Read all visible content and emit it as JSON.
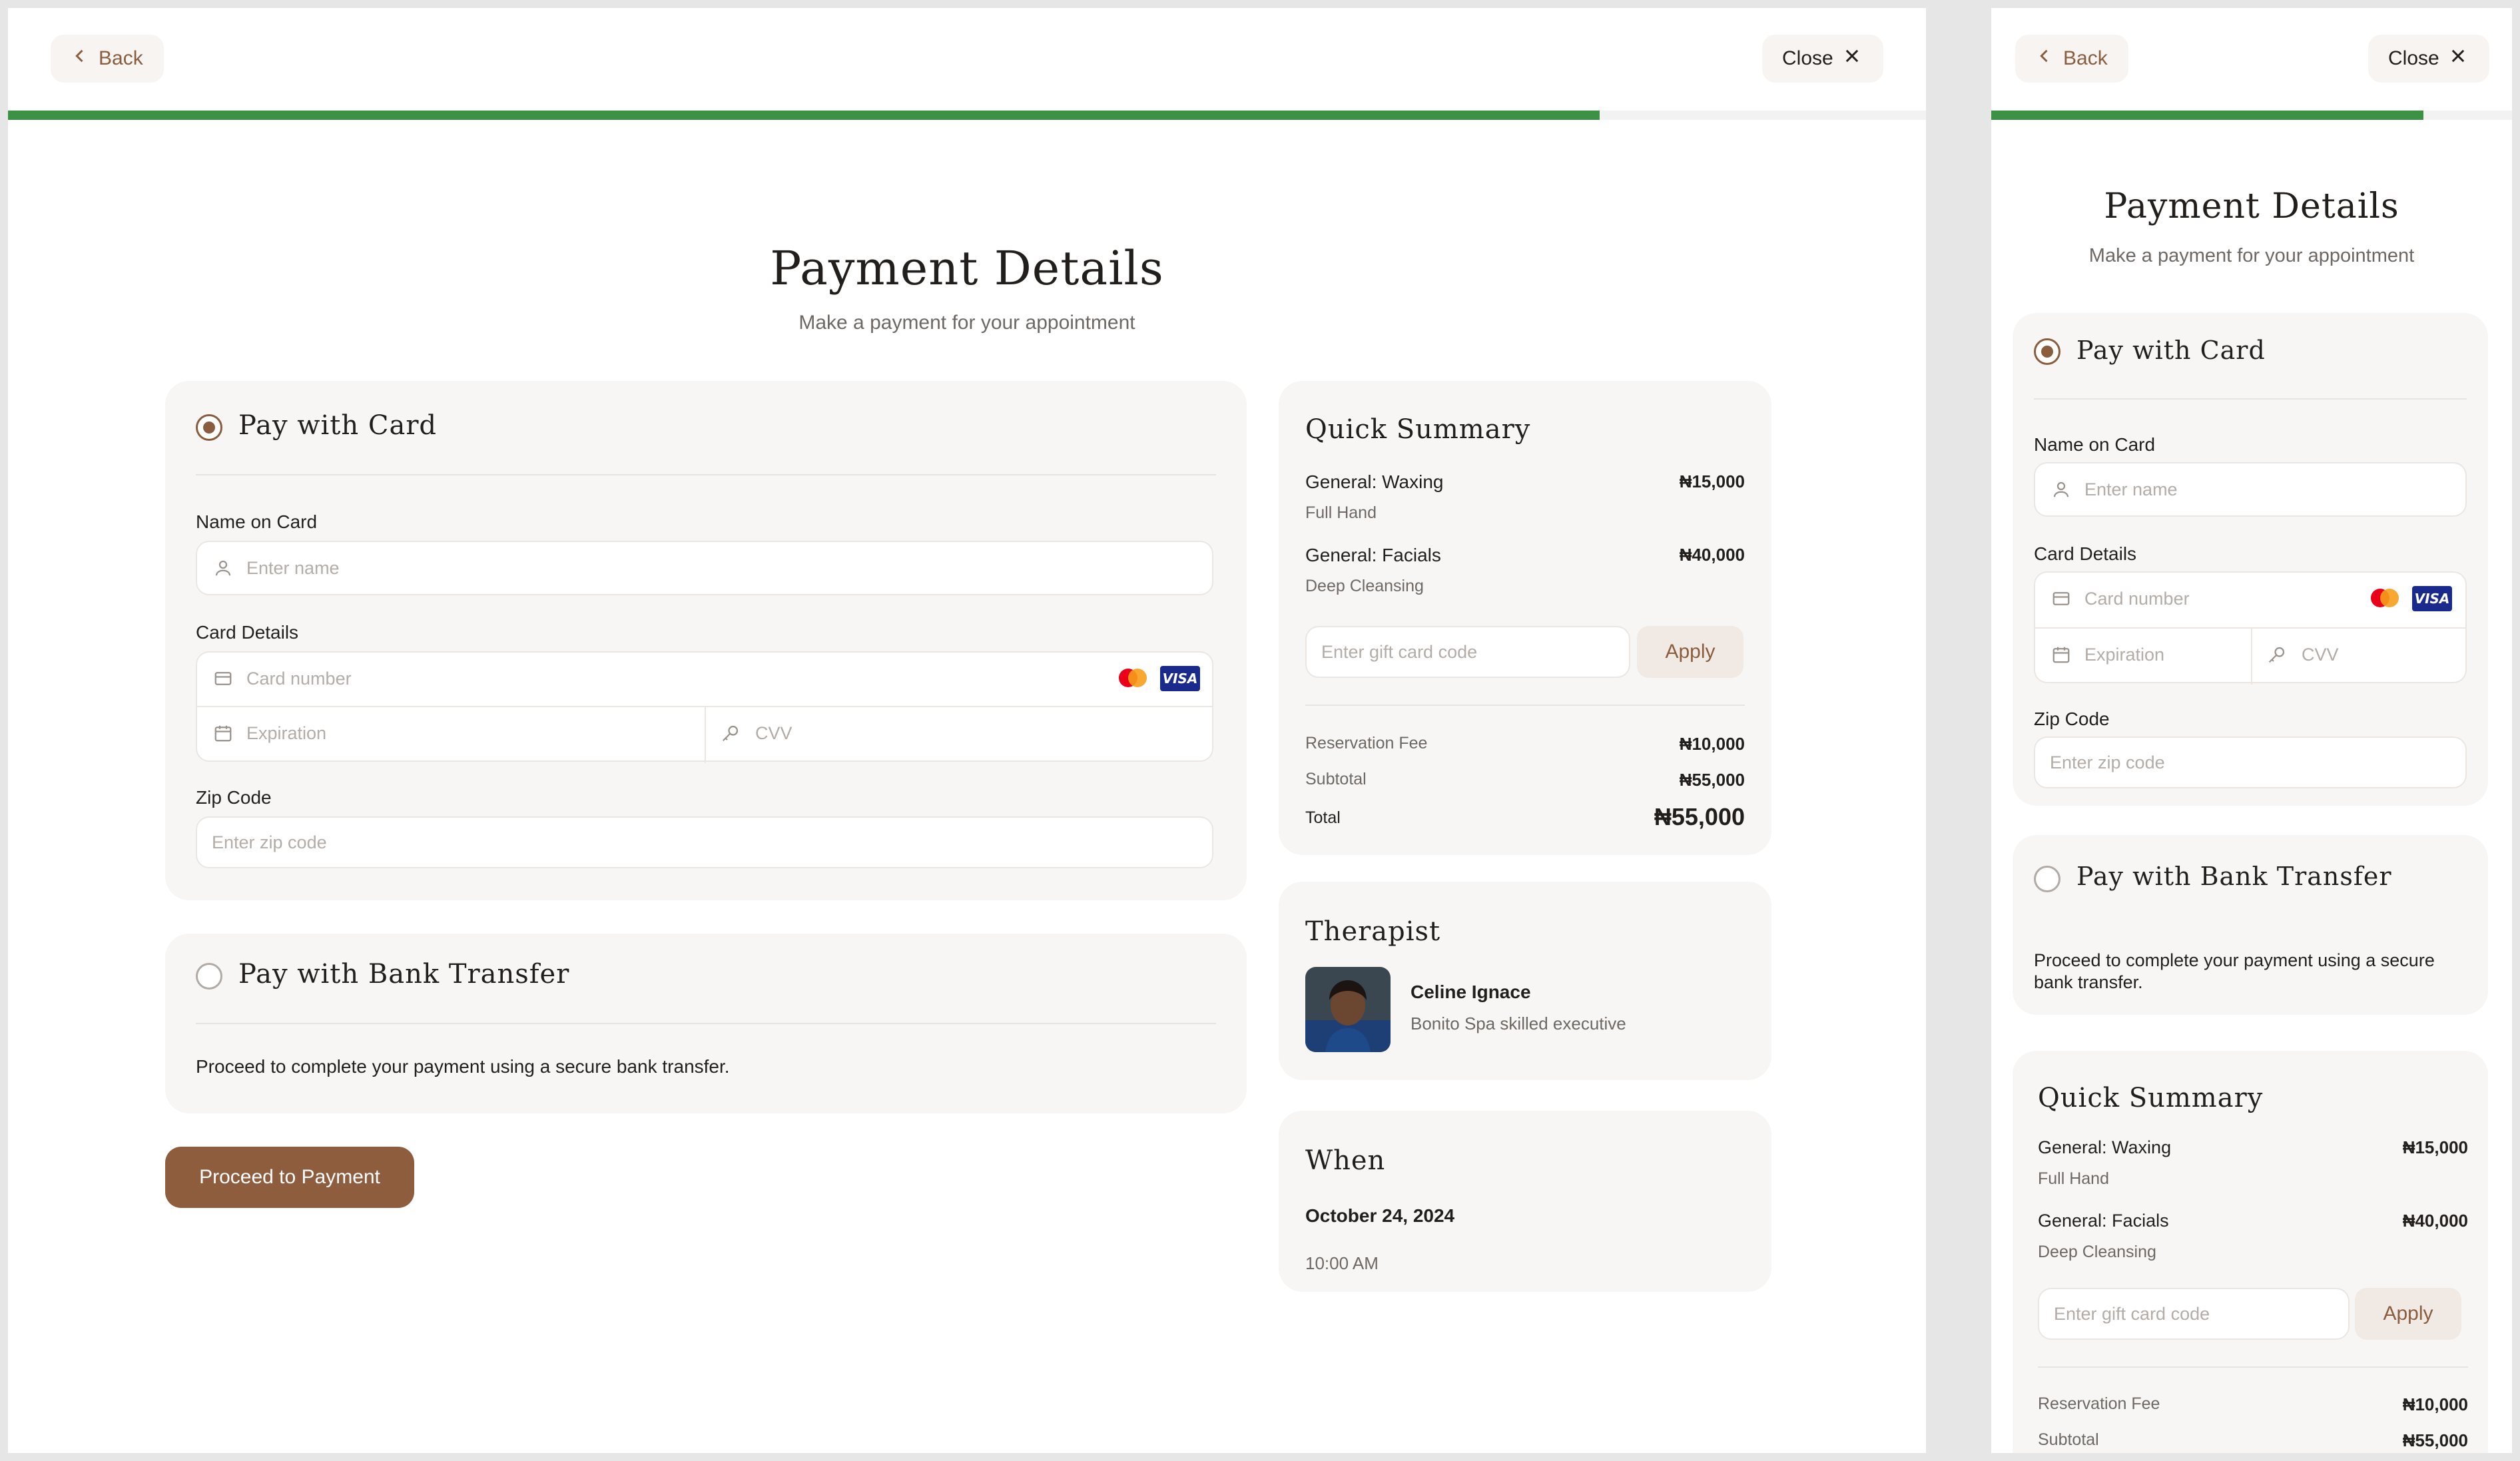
{
  "nav": {
    "back_label": "Back",
    "close_label": "Close"
  },
  "progress": {
    "fraction": 0.83
  },
  "page": {
    "title": "Payment Details",
    "subtitle": "Make a payment for your appointment"
  },
  "card_payment": {
    "title": "Pay with Card",
    "selected": true,
    "name_label": "Name on Card",
    "name_placeholder": "Enter name",
    "details_label": "Card Details",
    "number_placeholder": "Card number",
    "expiration_placeholder": "Expiration",
    "cvv_placeholder": "CVV",
    "zip_label": "Zip Code",
    "zip_placeholder": "Enter zip code",
    "brands": [
      "mastercard-icon",
      "visa-icon"
    ],
    "visa_text": "VISA"
  },
  "bank_transfer": {
    "title": "Pay with Bank Transfer",
    "selected": false,
    "description": "Proceed to complete your payment using a secure bank transfer."
  },
  "proceed_label": "Proceed to Payment",
  "summary": {
    "title": "Quick Summary",
    "items": [
      {
        "name": "General: Waxing",
        "detail": "Full Hand",
        "price": "₦15,000"
      },
      {
        "name": "General: Facials",
        "detail": "Deep Cleansing",
        "price": "₦40,000"
      }
    ],
    "gift_placeholder": "Enter gift card code",
    "apply_label": "Apply",
    "reservation_label": "Reservation Fee",
    "reservation_value": "₦10,000",
    "subtotal_label": "Subtotal",
    "subtotal_value": "₦55,000",
    "total_label": "Total",
    "total_value": "₦55,000"
  },
  "therapist": {
    "title": "Therapist",
    "name": "Celine Ignace",
    "role": "Bonito Spa skilled executive"
  },
  "when": {
    "title": "When",
    "date": "October 24, 2024",
    "time": "10:00 AM"
  },
  "colors": {
    "accent": "#8e5d3e",
    "progress": "#3c9145",
    "card_bg": "#f8f6f4"
  }
}
